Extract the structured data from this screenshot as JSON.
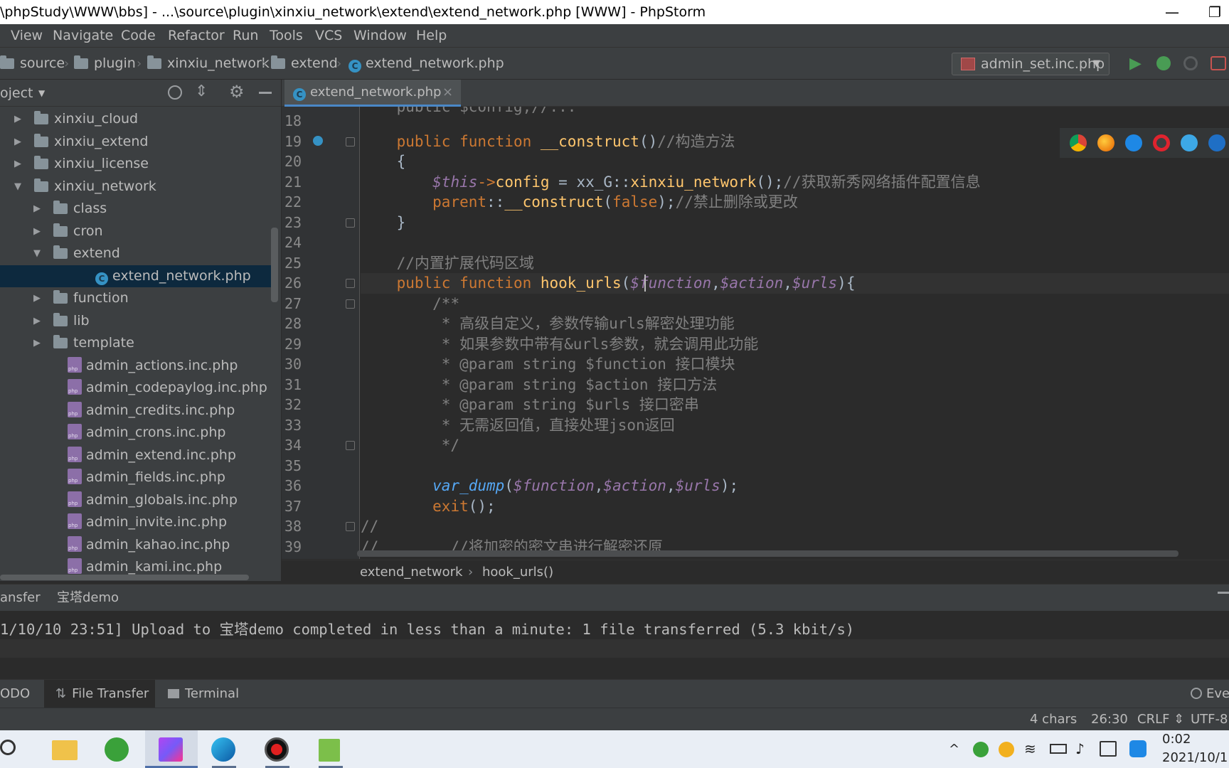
{
  "window": {
    "title": "\\phpStudy\\WWW\\bbs] - ...\\source\\plugin\\xinxiu_network\\extend\\extend_network.php [WWW] - PhpStorm",
    "minimize_glyph": "—",
    "restore_glyph": "❐"
  },
  "menu": [
    "View",
    "Navigate",
    "Code",
    "Refactor",
    "Run",
    "Tools",
    "VCS",
    "Window",
    "Help"
  ],
  "navbar": {
    "crumbs": [
      "source",
      "plugin",
      "xinxiu_network",
      "extend",
      "extend_network.php"
    ],
    "run_config": "admin_set.inc.php"
  },
  "project": {
    "title": "oject",
    "tree": [
      {
        "label": "xinxiu_cloud",
        "type": "folder",
        "level": 0,
        "expanded": false
      },
      {
        "label": "xinxiu_extend",
        "type": "folder",
        "level": 0,
        "expanded": false
      },
      {
        "label": "xinxiu_license",
        "type": "folder",
        "level": 0,
        "expanded": false
      },
      {
        "label": "xinxiu_network",
        "type": "folder",
        "level": 0,
        "expanded": true
      },
      {
        "label": "class",
        "type": "folder",
        "level": 1,
        "expanded": false
      },
      {
        "label": "cron",
        "type": "folder",
        "level": 1,
        "expanded": false
      },
      {
        "label": "extend",
        "type": "folder",
        "level": 1,
        "expanded": true
      },
      {
        "label": "extend_network.php",
        "type": "class",
        "level": 2,
        "selected": true
      },
      {
        "label": "function",
        "type": "folder",
        "level": 1,
        "expanded": false
      },
      {
        "label": "lib",
        "type": "folder",
        "level": 1,
        "expanded": false
      },
      {
        "label": "template",
        "type": "folder",
        "level": 1,
        "expanded": false
      },
      {
        "label": "admin_actions.inc.php",
        "type": "php",
        "level": 1
      },
      {
        "label": "admin_codepaylog.inc.php",
        "type": "php",
        "level": 1
      },
      {
        "label": "admin_credits.inc.php",
        "type": "php",
        "level": 1
      },
      {
        "label": "admin_crons.inc.php",
        "type": "php",
        "level": 1
      },
      {
        "label": "admin_extend.inc.php",
        "type": "php",
        "level": 1
      },
      {
        "label": "admin_fields.inc.php",
        "type": "php",
        "level": 1
      },
      {
        "label": "admin_globals.inc.php",
        "type": "php",
        "level": 1
      },
      {
        "label": "admin_invite.inc.php",
        "type": "php",
        "level": 1
      },
      {
        "label": "admin_kahao.inc.php",
        "type": "php",
        "level": 1
      },
      {
        "label": "admin_kami.inc.php",
        "type": "php",
        "level": 1
      }
    ]
  },
  "editor": {
    "tab_label": "extend_network.php",
    "tab_close": "×",
    "partial_line": "    public $config;//...",
    "lines": [
      {
        "n": "18",
        "tokens": []
      },
      {
        "n": "19",
        "tokens": [
          [
            "plain",
            "    "
          ],
          [
            "kw",
            "public function "
          ],
          [
            "fn",
            "__construct"
          ],
          [
            "plain",
            "()"
          ],
          [
            "cmt",
            "//构造方法"
          ]
        ]
      },
      {
        "n": "20",
        "tokens": [
          [
            "plain",
            "    {"
          ]
        ]
      },
      {
        "n": "21",
        "tokens": [
          [
            "plain",
            "        "
          ],
          [
            "var",
            "$this"
          ],
          [
            "kw",
            "->"
          ],
          [
            "fn",
            "config"
          ],
          [
            "plain",
            " = xx_G::"
          ],
          [
            "fn",
            "xinxiu_network"
          ],
          [
            "plain",
            "();"
          ],
          [
            "cmt",
            "//获取新秀网络插件配置信息"
          ]
        ]
      },
      {
        "n": "22",
        "tokens": [
          [
            "plain",
            "        "
          ],
          [
            "kw",
            "parent"
          ],
          [
            "plain",
            "::"
          ],
          [
            "fn",
            "__construct"
          ],
          [
            "plain",
            "("
          ],
          [
            "kw",
            "false"
          ],
          [
            "plain",
            ");"
          ],
          [
            "cmt",
            "//禁止删除或更改"
          ]
        ]
      },
      {
        "n": "23",
        "tokens": [
          [
            "plain",
            "    }"
          ]
        ]
      },
      {
        "n": "24",
        "tokens": []
      },
      {
        "n": "25",
        "tokens": [
          [
            "plain",
            "    "
          ],
          [
            "cmt",
            "//内置扩展代码区域"
          ]
        ]
      },
      {
        "n": "26",
        "tokens": [
          [
            "plain",
            "    "
          ],
          [
            "kw",
            "public function "
          ],
          [
            "fn",
            "hook_urls"
          ],
          [
            "plain",
            "("
          ],
          [
            "var",
            "$function"
          ],
          [
            "plain",
            ","
          ],
          [
            "var",
            "$action"
          ],
          [
            "plain",
            ","
          ],
          [
            "var",
            "$urls"
          ],
          [
            "plain",
            "){"
          ]
        ]
      },
      {
        "n": "27",
        "tokens": [
          [
            "plain",
            "        "
          ],
          [
            "cmt",
            "/**"
          ]
        ]
      },
      {
        "n": "28",
        "tokens": [
          [
            "cmt",
            "         * 高级自定义，参数传输urls解密处理功能"
          ]
        ]
      },
      {
        "n": "29",
        "tokens": [
          [
            "cmt",
            "         * 如果参数中带有&urls参数，就会调用此功能"
          ]
        ]
      },
      {
        "n": "30",
        "tokens": [
          [
            "cmt",
            "         * @param string $function 接口模块"
          ]
        ]
      },
      {
        "n": "31",
        "tokens": [
          [
            "cmt",
            "         * @param string $action 接口方法"
          ]
        ]
      },
      {
        "n": "32",
        "tokens": [
          [
            "cmt",
            "         * @param string $urls 接口密串"
          ]
        ]
      },
      {
        "n": "33",
        "tokens": [
          [
            "cmt",
            "         * 无需返回值，直接处理json返回"
          ]
        ]
      },
      {
        "n": "34",
        "tokens": [
          [
            "cmt",
            "         */"
          ]
        ]
      },
      {
        "n": "35",
        "tokens": []
      },
      {
        "n": "36",
        "tokens": [
          [
            "plain",
            "        "
          ],
          [
            "call",
            "var_dump"
          ],
          [
            "plain",
            "("
          ],
          [
            "var",
            "$function"
          ],
          [
            "plain",
            ","
          ],
          [
            "var",
            "$action"
          ],
          [
            "plain",
            ","
          ],
          [
            "var",
            "$urls"
          ],
          [
            "plain",
            ");"
          ]
        ]
      },
      {
        "n": "37",
        "tokens": [
          [
            "plain",
            "        "
          ],
          [
            "kw",
            "exit"
          ],
          [
            "plain",
            "();"
          ]
        ]
      },
      {
        "n": "38",
        "tokens": [
          [
            "cmt",
            "//"
          ]
        ]
      },
      {
        "n": "39",
        "tokens": [
          [
            "cmt",
            "//        //将加密的密文串进行解密还原"
          ]
        ]
      }
    ],
    "breadcrumb": [
      "extend_network",
      "hook_urls()"
    ]
  },
  "tool_window": {
    "tabs": [
      "ansfer",
      "宝塔demo"
    ],
    "output_line": "1/10/10 23:51] Upload to 宝塔demo completed in less than a minute: 1 file transferred (5.3 kbit/s)"
  },
  "bottom_tabs": [
    "ODO",
    "File Transfer",
    "Terminal"
  ],
  "event_log": "Eve",
  "status": {
    "selection": "4 chars",
    "position": "26:30",
    "line_sep": "CRLF ⇕",
    "encoding": "UTF-8"
  },
  "taskbar": {
    "time": "0:02",
    "date": "2021/10/1"
  },
  "colors": {
    "keyword": "#cc7832",
    "function": "#ffc66d",
    "variable": "#9876aa",
    "comment": "#808080",
    "selection": "#0d293e",
    "accent": "#4a88c7"
  }
}
